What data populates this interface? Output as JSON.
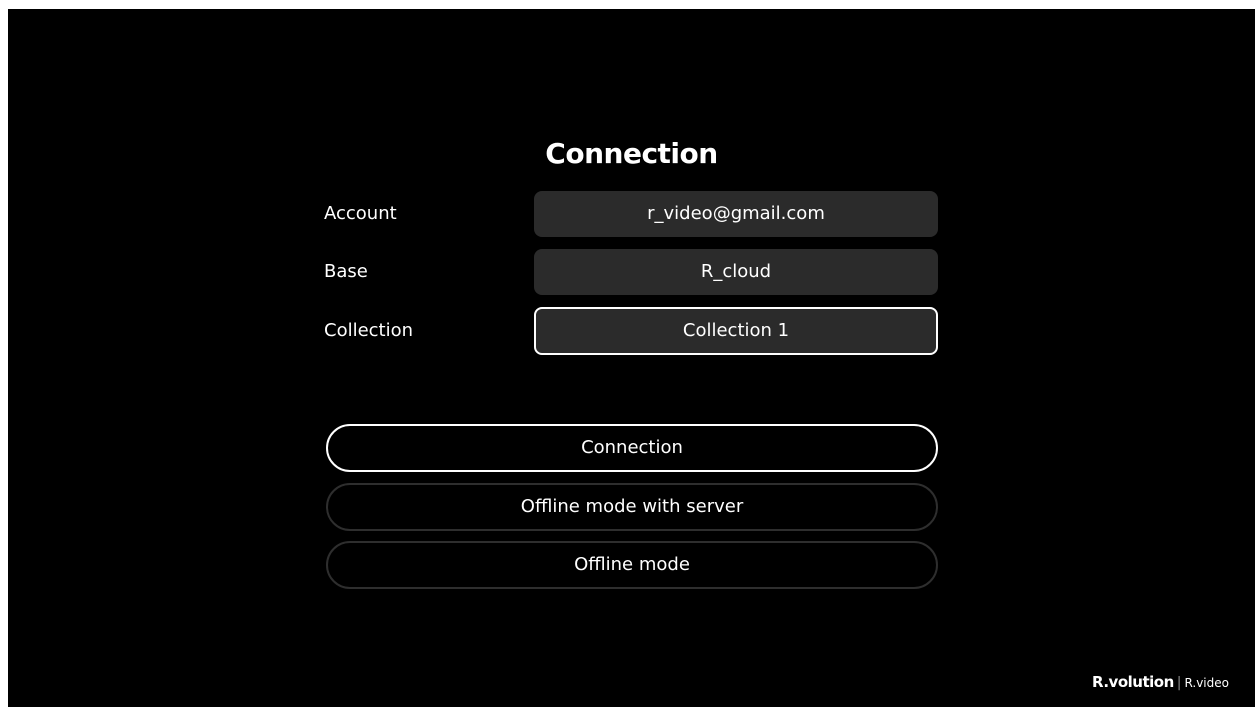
{
  "page": {
    "title": "Connection"
  },
  "form": {
    "account": {
      "label": "Account",
      "value": "r_video@gmail.com"
    },
    "base": {
      "label": "Base",
      "value": "R_cloud"
    },
    "collection": {
      "label": "Collection",
      "value": "Collection 1"
    }
  },
  "actions": {
    "connection": "Connection",
    "offline_with_server": "Offline mode with server",
    "offline": "Offline mode"
  },
  "brand": {
    "main": "R.volution",
    "separator": "|",
    "sub": "R.video"
  },
  "colors": {
    "background": "#000000",
    "field_bg": "#2b2b2b",
    "text": "#ffffff",
    "button_border": "#2e2e2e",
    "focus_border": "#ffffff"
  }
}
